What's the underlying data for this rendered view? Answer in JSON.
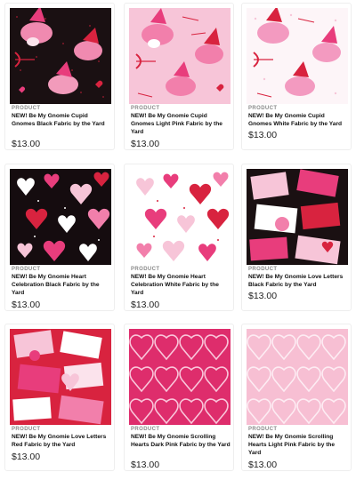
{
  "products": [
    {
      "label": "PRODUCT",
      "title": "NEW! Be My Gnomie Cupid Gnomes Black Fabric by the Yard",
      "price": "$13.00",
      "pattern": "cupid-black"
    },
    {
      "label": "PRODUCT",
      "title": "NEW! Be My Gnomie Cupid Gnomes Light Pink Fabric by the Yard",
      "price": "$13.00",
      "pattern": "cupid-pink"
    },
    {
      "label": "PRODUCT",
      "title": "NEW! Be My Gnomie Cupid Gnomes White Fabric by the Yard",
      "price": "$13.00",
      "pattern": "cupid-white"
    },
    {
      "label": "PRODUCT",
      "title": "NEW! Be My Gnomie Heart Celebration Black Fabric by the Yard",
      "price": "$13.00",
      "pattern": "hearts-black"
    },
    {
      "label": "PRODUCT",
      "title": "NEW! Be My Gnomie Heart Celebration White Fabric by the Yard",
      "price": "$13.00",
      "pattern": "hearts-white"
    },
    {
      "label": "PRODUCT",
      "title": "NEW! Be My Gnomie Love Letters Black Fabric by the Yard",
      "price": "$13.00",
      "pattern": "letters-black"
    },
    {
      "label": "PRODUCT",
      "title": "NEW! Be My Gnomie Love Letters Red Fabric by the Yard",
      "price": "$13.00",
      "pattern": "letters-red"
    },
    {
      "label": "PRODUCT",
      "title": "NEW! Be My Gnomie Scrolling Hearts Dark Pink Fabric by the Yard",
      "price": "$13.00",
      "pattern": "scroll-dark"
    },
    {
      "label": "PRODUCT",
      "title": "NEW! Be My Gnomie Scrolling Hearts Light Pink Fabric by the Yard",
      "price": "$13.00",
      "pattern": "scroll-light"
    }
  ],
  "colors": {
    "black": "#1a1012",
    "red": "#d8233f",
    "hot_pink": "#e83d7c",
    "light_pink": "#f7c5d8",
    "pale_pink": "#fbe3ec"
  }
}
